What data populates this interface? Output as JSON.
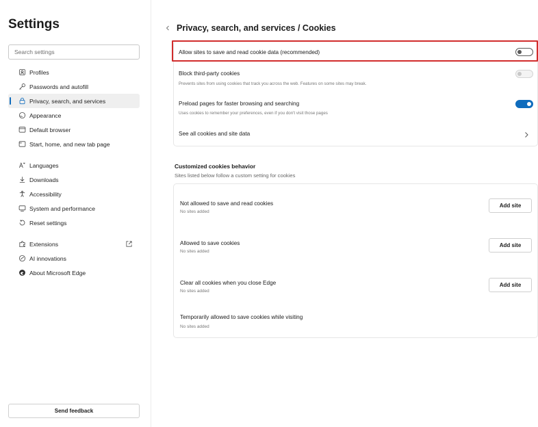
{
  "sidebar": {
    "title": "Settings",
    "search_placeholder": "Search settings",
    "items": [
      {
        "label": "Profiles",
        "icon": "profile-icon"
      },
      {
        "label": "Passwords and autofill",
        "icon": "key-icon"
      },
      {
        "label": "Privacy, search, and services",
        "icon": "lock-icon",
        "active": true
      },
      {
        "label": "Appearance",
        "icon": "appearance-icon"
      },
      {
        "label": "Default browser",
        "icon": "browser-icon"
      },
      {
        "label": "Start, home, and new tab page",
        "icon": "home-tab-icon"
      },
      {
        "label": "Languages",
        "icon": "languages-icon"
      },
      {
        "label": "Downloads",
        "icon": "download-icon"
      },
      {
        "label": "Accessibility",
        "icon": "accessibility-icon"
      },
      {
        "label": "System and performance",
        "icon": "system-icon"
      },
      {
        "label": "Reset settings",
        "icon": "reset-icon"
      },
      {
        "label": "Extensions",
        "icon": "extensions-icon"
      },
      {
        "label": "AI innovations",
        "icon": "ai-icon"
      },
      {
        "label": "About Microsoft Edge",
        "icon": "edge-icon"
      }
    ],
    "feedback_label": "Send feedback"
  },
  "main": {
    "title": "Privacy, search, and services / Cookies",
    "cookie_settings": [
      {
        "title": "Allow sites to save and read cookie data (recommended)",
        "desc": "",
        "toggle": "off"
      },
      {
        "title": "Block third-party cookies",
        "desc": "Prevents sites from using cookies that track you across the web. Features on some sites may break.",
        "toggle": "disabled"
      },
      {
        "title": "Preload pages for faster browsing and searching",
        "desc": "Uses cookies to remember your preferences, even if you don't visit those pages",
        "toggle": "on"
      },
      {
        "title": "See all cookies and site data",
        "desc": ""
      }
    ],
    "custom_section": {
      "title": "Customized cookies behavior",
      "desc": "Sites listed below follow a custom setting for cookies",
      "items": [
        {
          "title": "Not allowed to save and read cookies",
          "desc": "No sites added",
          "button": "Add site"
        },
        {
          "title": "Allowed to save cookies",
          "desc": "No sites added",
          "button": "Add site"
        },
        {
          "title": "Clear all cookies when you close Edge",
          "desc": "No sites added",
          "button": "Add site"
        },
        {
          "title": "Temporarily allowed to save cookies while visiting",
          "desc": "No sites added"
        }
      ]
    }
  },
  "colors": {
    "accent": "#0f6cbd",
    "highlight": "#d12c2c"
  }
}
